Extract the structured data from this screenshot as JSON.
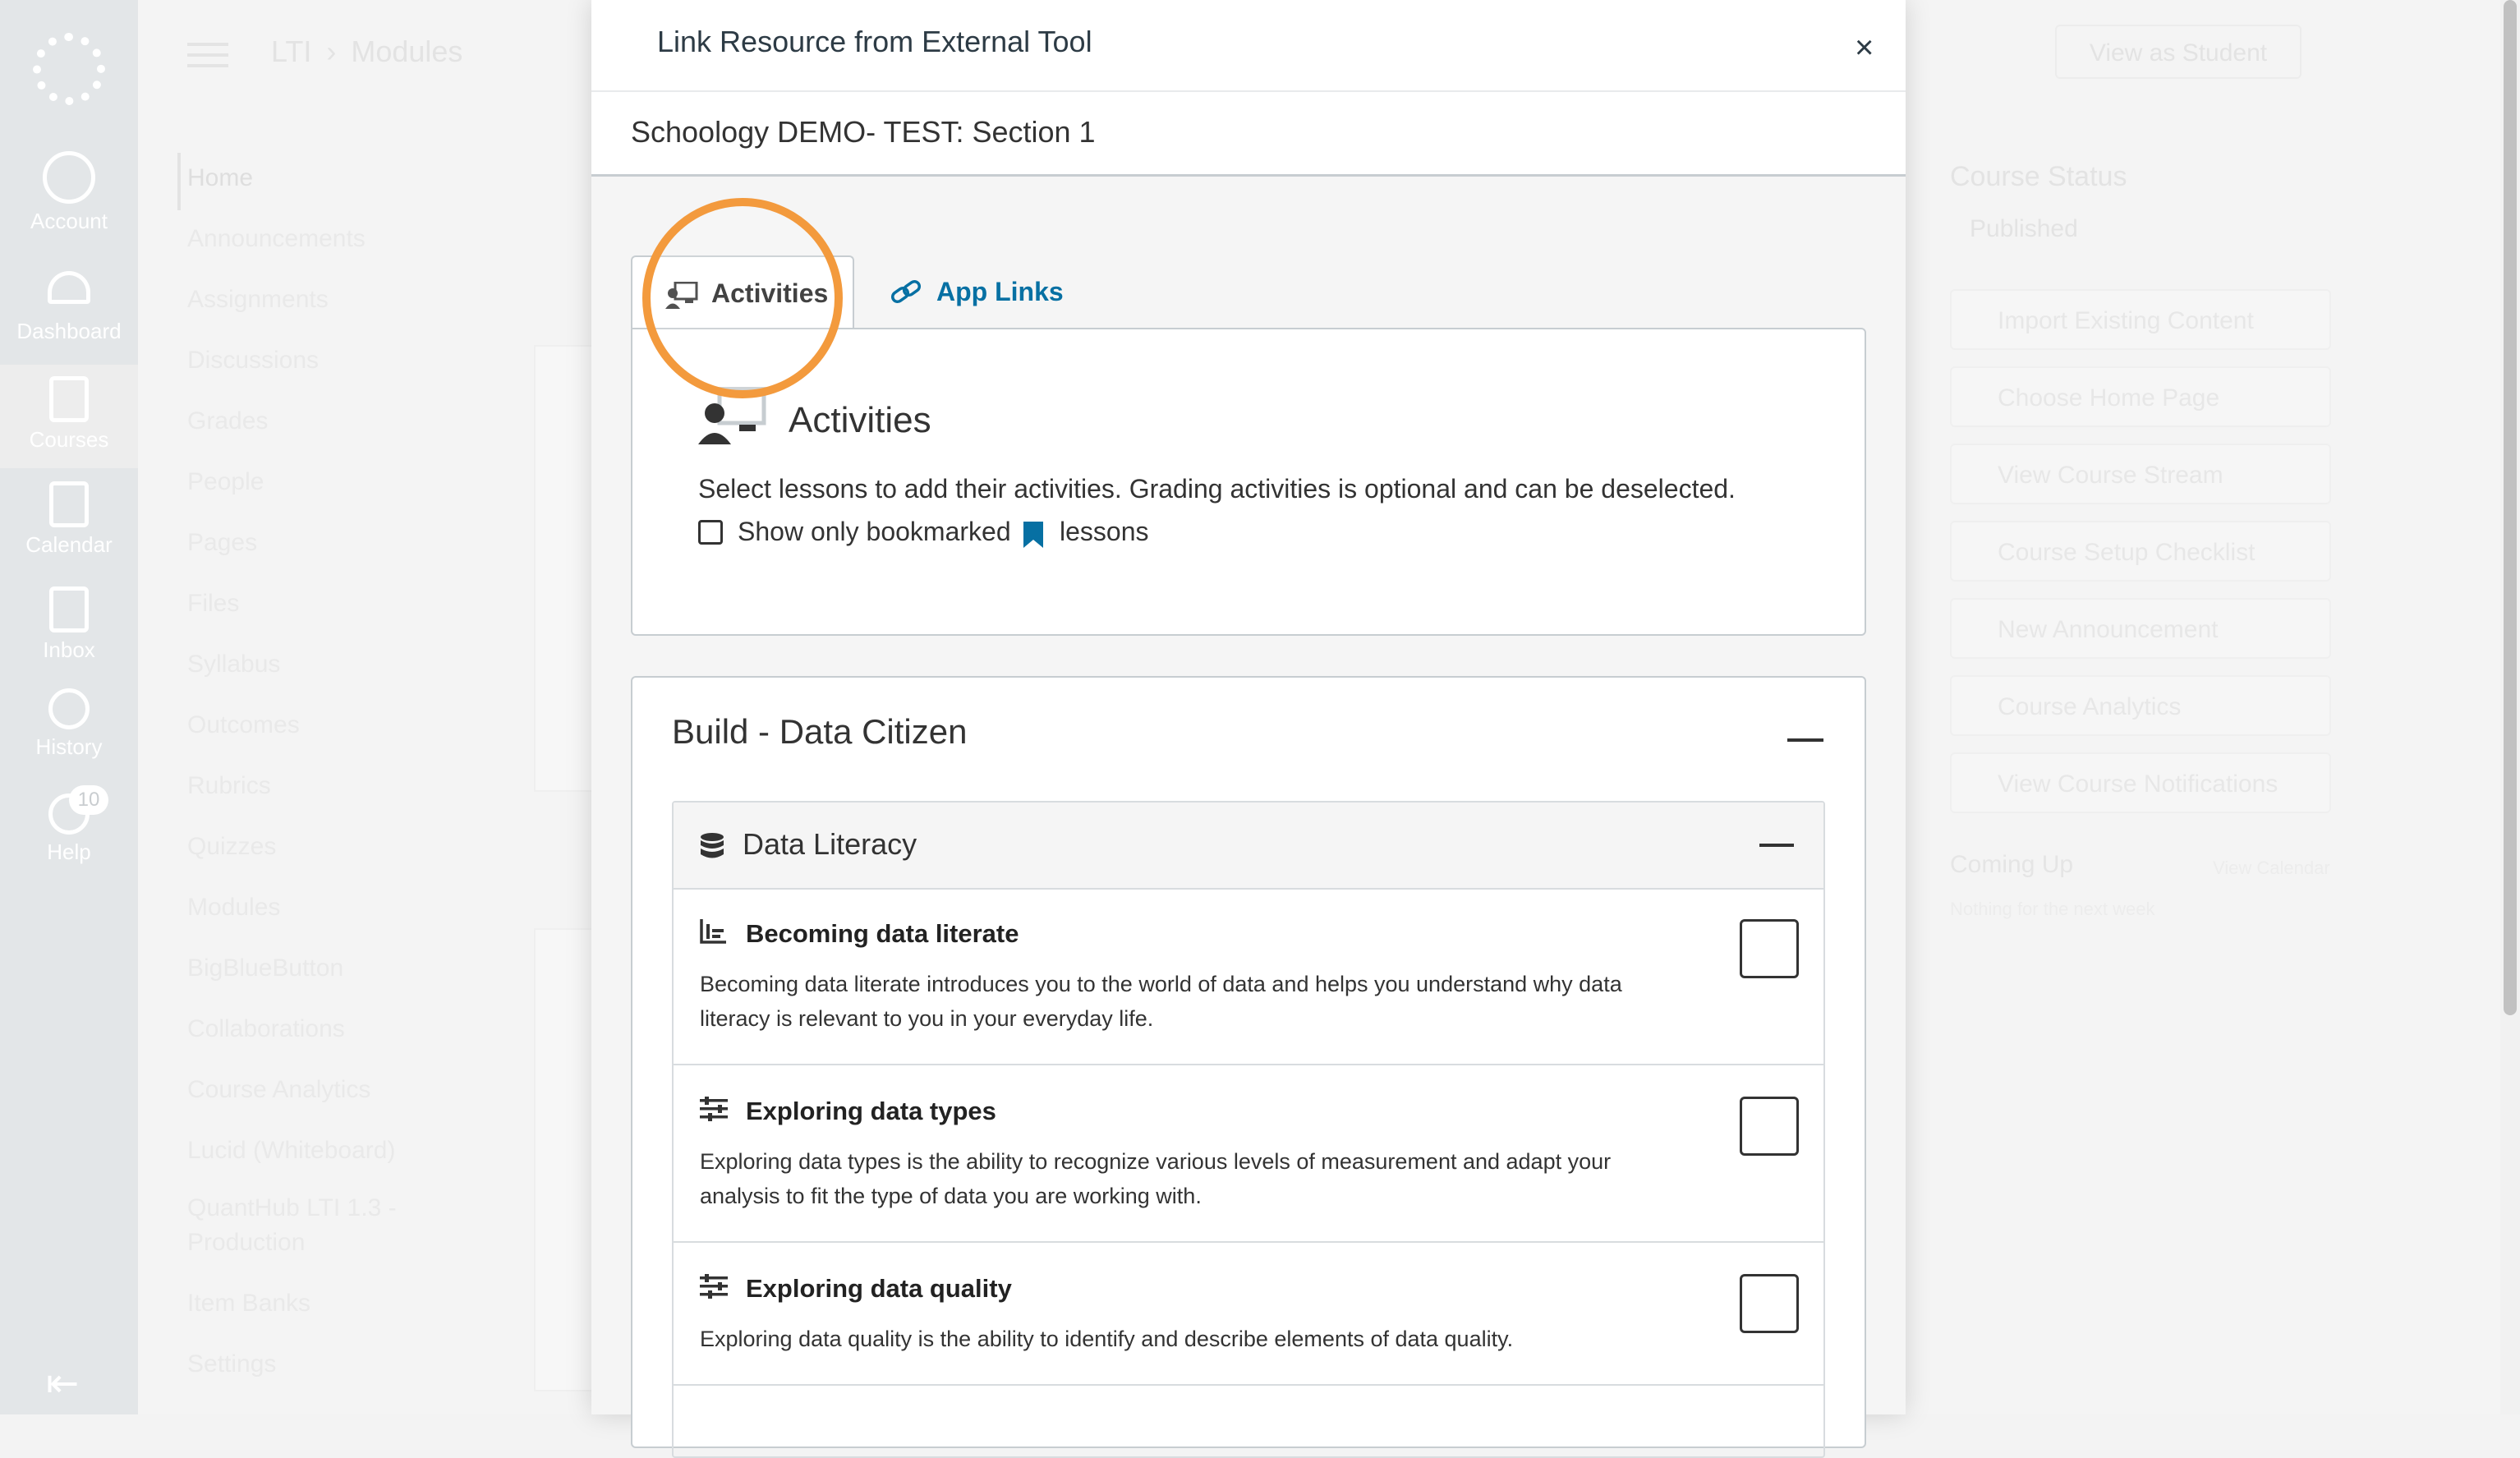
{
  "global_nav": {
    "items": [
      {
        "label": "Account"
      },
      {
        "label": "Dashboard"
      },
      {
        "label": "Courses"
      },
      {
        "label": "Calendar"
      },
      {
        "label": "Inbox"
      },
      {
        "label": "History"
      },
      {
        "label": "Help"
      }
    ],
    "help_badge": "10"
  },
  "breadcrumb": [
    "LTI",
    "›",
    "Modules"
  ],
  "course_nav": [
    "Home",
    "Announcements",
    "Assignments",
    "Discussions",
    "Grades",
    "People",
    "Pages",
    "Files",
    "Syllabus",
    "Outcomes",
    "Rubrics",
    "Quizzes",
    "Modules",
    "BigBlueButton",
    "Collaborations",
    "Course Analytics",
    "Lucid (Whiteboard)",
    "QuantHub LTI 1.3 -",
    "Production",
    "Item Banks",
    "Settings"
  ],
  "header": {
    "view_as_student": "View as Student"
  },
  "sidebar_right": {
    "course_status": "Course Status",
    "published": "Published",
    "buttons": [
      "Import Existing Content",
      "Choose Home Page",
      "View Course Stream",
      "Course Setup Checklist",
      "New Announcement",
      "Course Analytics",
      "View Course Notifications"
    ],
    "coming_up": "Coming Up",
    "view_calendar": "View Calendar",
    "nothing": "Nothing for the next week"
  },
  "modal": {
    "title": "Link Resource from External Tool",
    "close": "×",
    "section": "Schoology DEMO- TEST: Section 1",
    "tabs": {
      "activities": "Activities",
      "app_links": "App Links"
    },
    "panel": {
      "heading": "Activities",
      "description": "Select lessons to add their activities. Grading activities is optional and can be deselected.",
      "bookmark_label_1": "Show only bookmarked",
      "bookmark_label_2": "lessons"
    },
    "build": {
      "title": "Build - Data Citizen",
      "group": {
        "title": "Data Literacy",
        "lessons": [
          {
            "title": "Becoming data literate",
            "desc1": "Becoming data literate introduces you to the world of data and helps you understand why data",
            "desc2": "literacy is relevant to you in your everyday life."
          },
          {
            "title": "Exploring data types",
            "desc1": "Exploring data types is the ability to recognize various levels of measurement and adapt your",
            "desc2": "analysis to fit the type of data you are working with."
          },
          {
            "title": "Exploring data quality",
            "desc1": "Exploring data quality is the ability to identify and describe elements of data quality.",
            "desc2": ""
          }
        ]
      }
    }
  },
  "colors": {
    "accent_link": "#0770a3",
    "highlight_ring": "#f39a3d",
    "bookmark": "#0770a3"
  }
}
